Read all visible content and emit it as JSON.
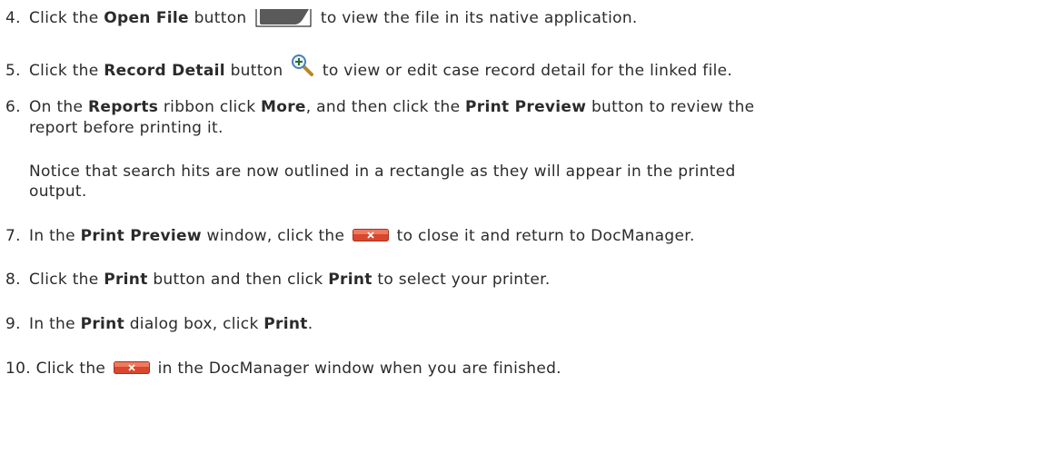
{
  "steps": [
    {
      "num": "4.",
      "t1": "Click the ",
      "b1": "Open File",
      "t2": " button ",
      "t3": " to view the file in its native application."
    },
    {
      "num": "5.",
      "t1": "Click the ",
      "b1": "Record Detail",
      "t2": " button ",
      "t3": " to view or edit case record detail for the linked file."
    },
    {
      "num": "6.",
      "t1": "On the ",
      "b1": "Reports",
      "t2": " ribbon click ",
      "b2": "More",
      "t3": ", and then click the ",
      "b3": "Print Preview",
      "t4": " button to review the",
      "line2": "report before printing it."
    },
    {
      "num": "",
      "line1": "Notice that search hits are now outlined in a rectangle as they will appear in the printed",
      "line2": "output."
    },
    {
      "num": "7.",
      "t1": "In the ",
      "b1": "Print Preview",
      "t2": " window, click the ",
      "t3": " to close it and return to DocManager."
    },
    {
      "num": "8.",
      "t1": "Click the ",
      "b1": "Print",
      "t2": " button and then click ",
      "b2": "Print",
      "t3": " to select your printer."
    },
    {
      "num": "9.",
      "t1": "In the ",
      "b1": "Print",
      "t2": " dialog box, click ",
      "b2": "Print",
      "t3": "."
    },
    {
      "num": "10.",
      "t1": "Click the ",
      "t2": " in the DocManager window when you are finished."
    }
  ],
  "icons": {
    "open_file": "open-file-icon",
    "record_detail": "magnifier-icon",
    "close": "close-icon"
  },
  "colors": {
    "text": "#2b2b2b",
    "close_button": "#d9472e",
    "open_file_button": "#5a5a5a"
  }
}
